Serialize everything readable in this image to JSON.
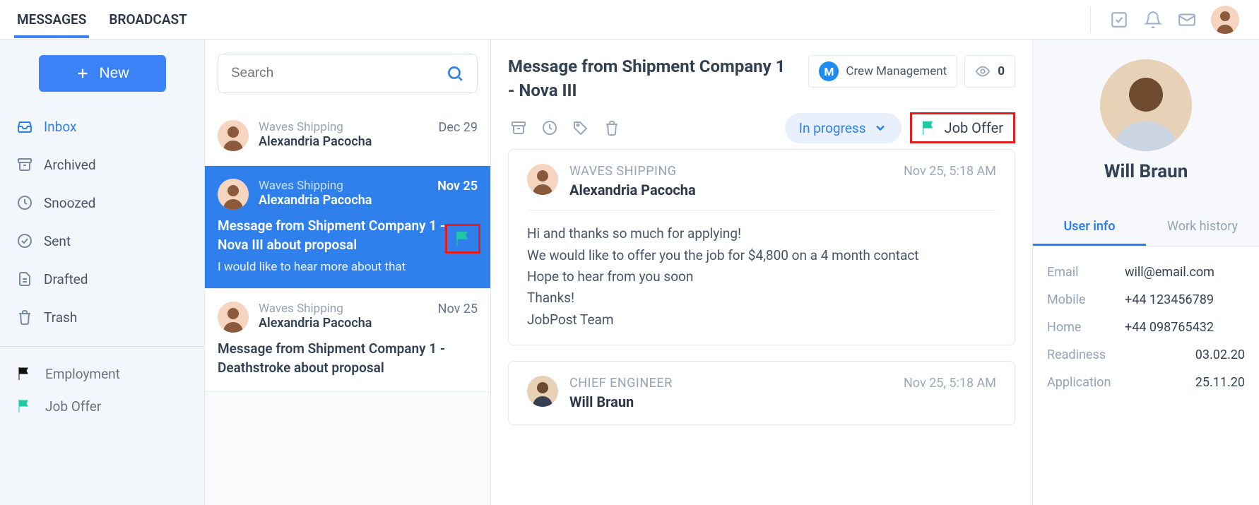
{
  "top": {
    "tabs": {
      "messages": "MESSAGES",
      "broadcast": "BROADCAST"
    }
  },
  "sidebar": {
    "new_label": "New",
    "folders": {
      "inbox": "Inbox",
      "archived": "Archived",
      "snoozed": "Snoozed",
      "sent": "Sent",
      "drafted": "Drafted",
      "trash": "Trash"
    },
    "labels": {
      "employment": "Employment",
      "job_offer": "Job Offer"
    }
  },
  "search": {
    "placeholder": "Search"
  },
  "messages": [
    {
      "company": "Waves Shipping",
      "sender": "Alexandria Pacocha",
      "date": "Dec 29"
    },
    {
      "company": "Waves Shipping",
      "sender": "Alexandria Pacocha",
      "date": "Nov 25",
      "subject": "Message from Shipment Company 1 - Nova III about proposal",
      "preview": "I would like to hear more about that"
    },
    {
      "company": "Waves Shipping",
      "sender": "Alexandria Pacocha",
      "date": "Nov 25",
      "subject": "Message from Shipment Company 1 - Deathstroke about proposal"
    }
  ],
  "reader": {
    "title": "Message from Shipment Company 1 - Nova III",
    "context": {
      "dept": "Crew Management",
      "watchers": "0"
    },
    "status": "In progress",
    "label": "Job Offer",
    "thread": [
      {
        "company": "WAVES SHIPPING",
        "name": "Alexandria Pacocha",
        "date": "Nov 25, 5:18 AM",
        "body": "Hi and thanks so much for applying!\nWe would like to offer you the job for $4,800 on a 4 month contact\nHope to hear from you soon\nThanks!\nJobPost Team"
      },
      {
        "company": "CHIEF ENGINEER",
        "name": "Will Braun",
        "date": "Nov 25, 5:18 AM"
      }
    ]
  },
  "profile": {
    "name": "Will Braun",
    "tabs": {
      "user_info": "User info",
      "work_history": "Work history"
    },
    "info": {
      "email_key": "Email",
      "email_val": "will@email.com",
      "mobile_key": "Mobile",
      "mobile_val": "+44 123456789",
      "home_key": "Home",
      "home_val": "+44 098765432",
      "readiness_key": "Readiness",
      "readiness_val": "03.02.20",
      "application_key": "Application",
      "application_val": "25.11.20"
    }
  }
}
